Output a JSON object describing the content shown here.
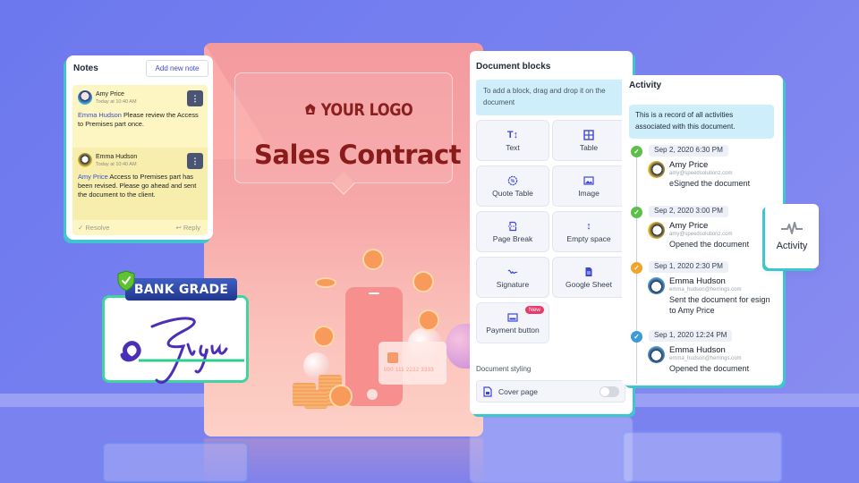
{
  "notes": {
    "title": "Notes",
    "add_button": "Add new note",
    "items": [
      {
        "author": "Amy Price",
        "time": "Today at 10:40 AM",
        "mention": "Emma Hudson",
        "text": "Please review the Access to Premises part once."
      },
      {
        "author": "Emma Hudson",
        "time": "Today at 10:40 AM",
        "mention": "Amy Price",
        "text": "Access to Premises part has been revised. Please go ahead and sent the document to the client."
      }
    ],
    "resolve_label": "Resolve",
    "reply_label": "Reply",
    "menu_glyph": "⋮"
  },
  "badge": {
    "label": "BANK GRADE",
    "signature_text": "eSign"
  },
  "document": {
    "logo_text": "YOUR LOGO",
    "title": "Sales Contract",
    "card_number": "000 111 2222 3333"
  },
  "blocks": {
    "title": "Document blocks",
    "hint": "To add a block, drag and drop it on the document",
    "items": [
      {
        "label": "Text",
        "icon": "text-icon"
      },
      {
        "label": "Table",
        "icon": "table-icon"
      },
      {
        "label": "Quote Table",
        "icon": "quote-table-icon"
      },
      {
        "label": "Image",
        "icon": "image-icon"
      },
      {
        "label": "Page Break",
        "icon": "page-break-icon"
      },
      {
        "label": "Empty space",
        "icon": "empty-space-icon"
      },
      {
        "label": "Signature",
        "icon": "signature-icon"
      },
      {
        "label": "Google Sheet",
        "icon": "google-sheet-icon"
      },
      {
        "label": "Payment button",
        "icon": "payment-icon",
        "badge": "New"
      }
    ],
    "styling_label": "Document styling",
    "cover_page_label": "Cover page",
    "cover_page_enabled": false
  },
  "activity": {
    "title": "Activity",
    "hint": "This is a record of all activities associated with this document.",
    "items": [
      {
        "date": "Sep 2, 2020 6:30 PM",
        "name": "Amy Price",
        "email": "amy@speedsolutionz.com",
        "action": "eSigned the document",
        "status_color": "#5cbf4a"
      },
      {
        "date": "Sep 2, 2020 3:00 PM",
        "name": "Amy Price",
        "email": "amy@speedsolutionz.com",
        "action": "Opened the document",
        "status_color": "#5cbf4a"
      },
      {
        "date": "Sep 1, 2020 2:30 PM",
        "name": "Emma Hudson",
        "email": "emma_hudson@herrings.com",
        "action": "Sent the document for esign to Amy Price",
        "status_color": "#f0a52a"
      },
      {
        "date": "Sep 1, 2020 12:24 PM",
        "name": "Emma Hudson",
        "email": "emma_hudson@herrings.com",
        "action": "Opened the document",
        "status_color": "#3b9bd6"
      }
    ],
    "chip_label": "Activity"
  },
  "colors": {
    "background": "#7279ee",
    "accent_teal": "#3ec5cf",
    "accent_blue": "#3d46d6",
    "doc_pink": "#f39a9e",
    "title_red": "#8a1b1b"
  }
}
